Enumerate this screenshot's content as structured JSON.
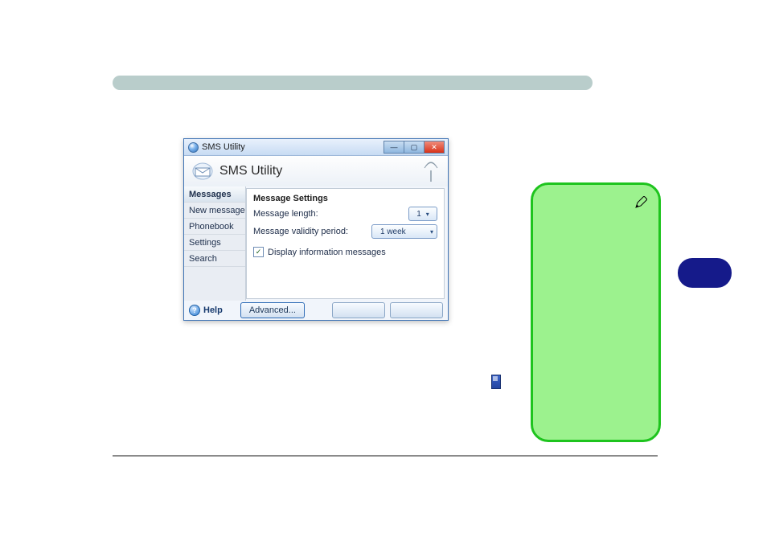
{
  "window": {
    "title": "SMS Utility",
    "app_title": "SMS Utility"
  },
  "sidebar": {
    "items": [
      {
        "label": "Messages"
      },
      {
        "label": "New message"
      },
      {
        "label": "Phonebook"
      },
      {
        "label": "Settings"
      },
      {
        "label": "Search"
      }
    ]
  },
  "content": {
    "section_title": "Message Settings",
    "rows": {
      "length_label": "Message length:",
      "length_value": "1",
      "validity_label": "Message validity period:",
      "validity_value": "1 week"
    },
    "checkbox": {
      "checked": true,
      "label": "Display information messages"
    }
  },
  "footer": {
    "help_label": "Help",
    "advanced_label": "Advanced..."
  },
  "icons": {
    "pencil": "pencil-icon",
    "antenna": "antenna-icon",
    "envelope": "envelope-icon",
    "help": "help-icon",
    "orb": "app-orb-icon"
  }
}
